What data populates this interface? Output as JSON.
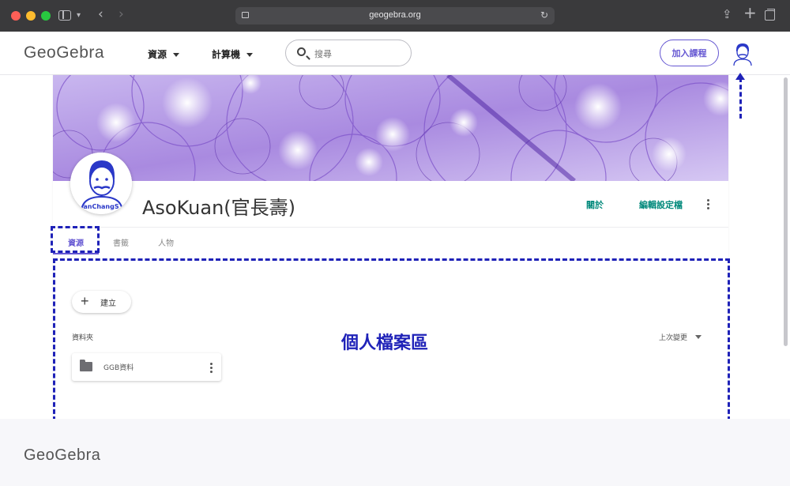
{
  "browser": {
    "url": "geogebra.org"
  },
  "header": {
    "logo": "GeoGebra",
    "nav": [
      {
        "label": "資源"
      },
      {
        "label": "計算機"
      }
    ],
    "search_placeholder": "搜尋",
    "join_button": "加入課程"
  },
  "profile": {
    "name": "AsoKuan(官長壽)",
    "avatar_caption": "anChangS",
    "about_link": "關於",
    "edit_link": "編輯設定檔",
    "tabs": [
      {
        "label": "資源",
        "selected": true
      },
      {
        "label": "書籤",
        "selected": false
      },
      {
        "label": "人物",
        "selected": false
      }
    ]
  },
  "content": {
    "create_button": "建立",
    "folders_label": "資料夾",
    "sort_label": "上次變更",
    "folders": [
      {
        "name": "GGB資料"
      }
    ]
  },
  "annotation": {
    "title": "個人檔案區",
    "color": "#1f22b8"
  },
  "footer": {
    "logo": "GeoGebra"
  },
  "colors": {
    "accent": "#6557d2",
    "link": "#00897b"
  }
}
